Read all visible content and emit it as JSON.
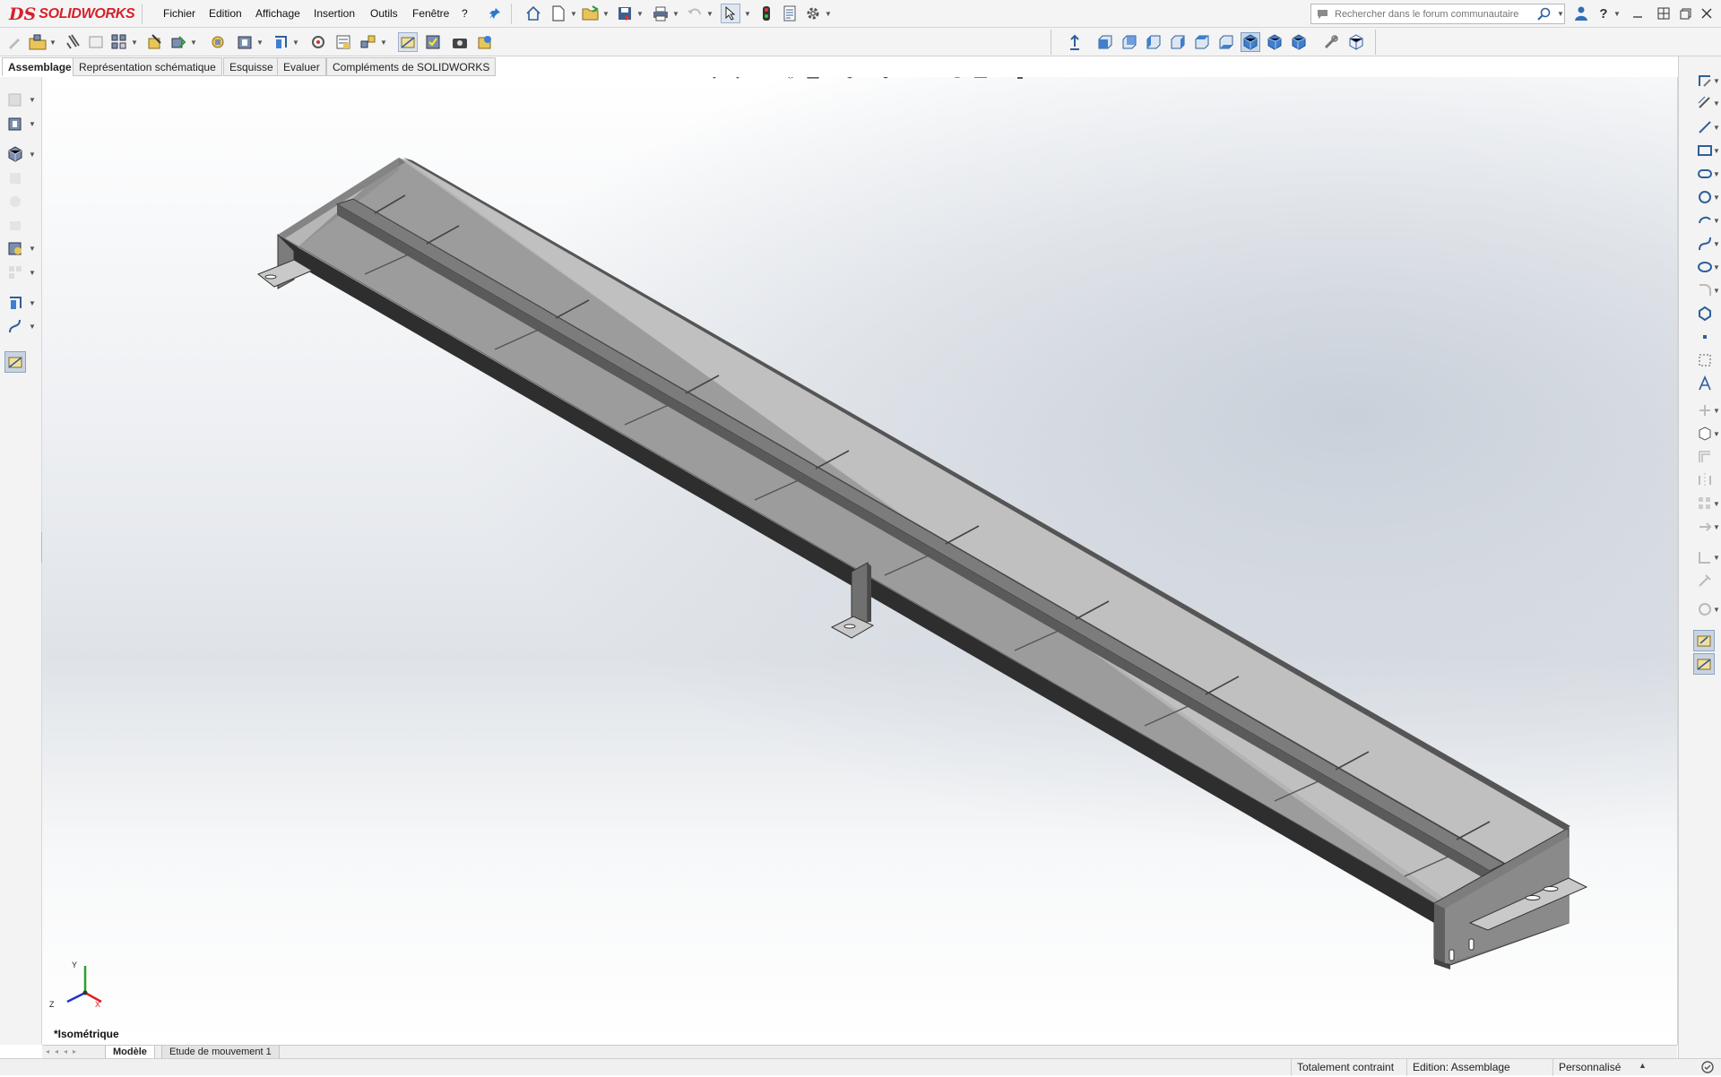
{
  "app": {
    "logo_prefix": "DS",
    "logo_name": "SOLIDWORKS"
  },
  "menu": {
    "items": [
      "Fichier",
      "Edition",
      "Affichage",
      "Insertion",
      "Outils",
      "Fenêtre",
      "?"
    ]
  },
  "search": {
    "placeholder": "Rechercher dans le forum communautaire"
  },
  "tabs": {
    "items": [
      "Assemblage",
      "Représentation schématique",
      "Esquisse",
      "Evaluer",
      "Compléments de SOLIDWORKS"
    ],
    "active": "Assemblage"
  },
  "viewport": {
    "view_name": "*Isométrique",
    "triad_x": "X",
    "triad_y": "Y",
    "triad_z": "Z"
  },
  "bottom_tabs": {
    "items": [
      "Modèle",
      "Etude de mouvement 1"
    ],
    "active": "Modèle"
  },
  "status": {
    "constraint": "Totalement contraint",
    "mode": "Edition: Assemblage",
    "units": "Personnalisé"
  },
  "colors": {
    "brand": "#d7202a",
    "part_gray": "#a8a8a8"
  }
}
